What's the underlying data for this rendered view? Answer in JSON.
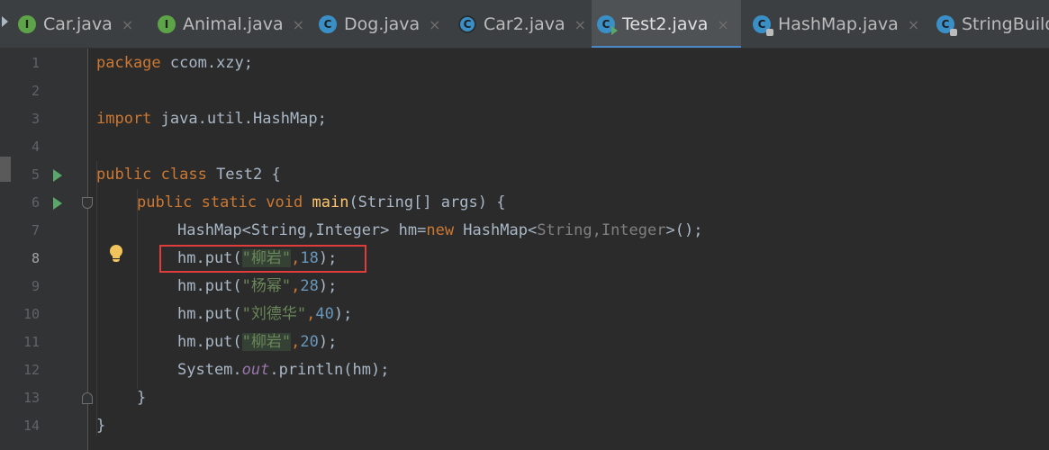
{
  "tabs": [
    {
      "label": "Car.java",
      "icon": "I",
      "icon_type": "interface",
      "close": "×"
    },
    {
      "label": "Animal.java",
      "icon": "I",
      "icon_type": "interface",
      "close": "×"
    },
    {
      "label": "Dog.java",
      "icon": "C",
      "icon_type": "class",
      "close": "×"
    },
    {
      "label": "Car2.java",
      "icon": "C",
      "icon_type": "abstract-class",
      "close": "×"
    },
    {
      "label": "Test2.java",
      "icon": "C",
      "icon_type": "runnable-class",
      "close": "×",
      "active": true
    },
    {
      "label": "HashMap.java",
      "icon": "C",
      "icon_type": "library-class",
      "close": "×"
    },
    {
      "label": "StringBuild",
      "icon": "C",
      "icon_type": "library-class"
    }
  ],
  "gutter": {
    "line_numbers": [
      "1",
      "2",
      "3",
      "4",
      "5",
      "6",
      "7",
      "8",
      "9",
      "10",
      "11",
      "12",
      "13",
      "14"
    ],
    "current_line": "8"
  },
  "code": {
    "l1_kw": "package",
    "l1_rest": " ccom.xzy;",
    "l3_kw": "import",
    "l3_rest": " java.util.HashMap;",
    "l5_kw": "public class",
    "l5_rest": " Test2 {",
    "l6_kw": "public static void",
    "l6_fn": "main",
    "l6_rest": "(String[] args) {",
    "l7_a": "HashMap<String,Integer> hm=",
    "l7_kw": "new",
    "l7_b": " HashMap<",
    "l7_gen": "String,Integer",
    "l7_c": ">();",
    "l8_a": "hm.put(",
    "l8_str": "\"柳岩\"",
    "l8_comma": ",",
    "l8_num": "18",
    "l8_end": ");",
    "l9_a": "hm.put(",
    "l9_str": "\"杨幂\"",
    "l9_comma": ",",
    "l9_num": "28",
    "l9_end": ");",
    "l10_a": "hm.put(",
    "l10_str": "\"刘德华\"",
    "l10_comma": ",",
    "l10_num": "40",
    "l10_end": ");",
    "l11_a": "hm.put(",
    "l11_str": "\"柳岩\"",
    "l11_comma": ",",
    "l11_num": "20",
    "l11_end": ");",
    "l12_a": "System.",
    "l12_stat": "out",
    "l12_b": ".println(hm);",
    "l13": "}",
    "l14": "}"
  },
  "colors": {
    "background": "#2b2b2b",
    "keyword": "#cc7832",
    "string": "#6a8759",
    "number": "#6897bb",
    "method": "#ffc66d",
    "static_field": "#9876aa",
    "annotation_box": "#e03c3c",
    "active_tab_underline": "#4a88c7"
  }
}
